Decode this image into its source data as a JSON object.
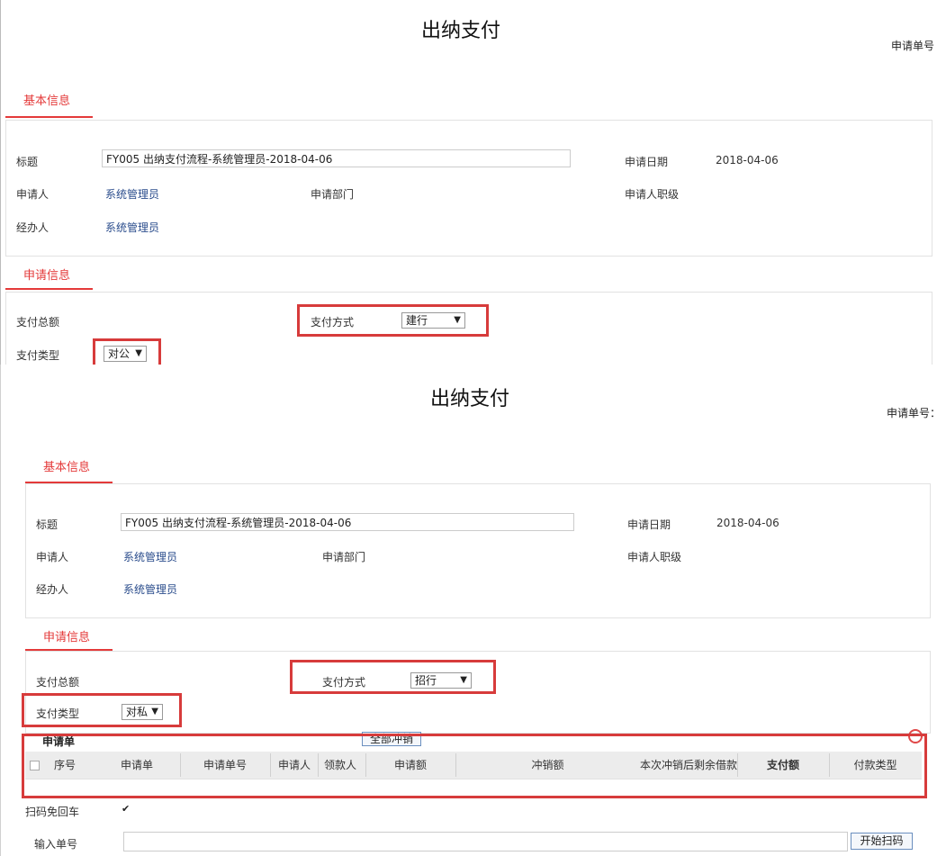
{
  "panel1": {
    "title": "出纳支付",
    "app_no_label": "申请单号",
    "tab_basic": "基本信息",
    "tab_request": "申请信息",
    "fields": {
      "title_label": "标题",
      "title_value": "FY005 出纳支付流程-系统管理员-2018-04-06",
      "date_label": "申请日期",
      "date_value": "2018-04-06",
      "applicant_label": "申请人",
      "applicant_value": "系统管理员",
      "dept_label": "申请部门",
      "rank_label": "申请人职级",
      "handler_label": "经办人",
      "handler_value": "系统管理员"
    },
    "pay": {
      "total_label": "支付总额",
      "method_label": "支付方式",
      "method_value": "建行",
      "type_label": "支付类型",
      "type_value": "对公"
    }
  },
  "panel2": {
    "title": "出纳支付",
    "app_no_label": "申请单号：",
    "tab_basic": "基本信息",
    "tab_request": "申请信息",
    "fields": {
      "title_label": "标题",
      "title_value": "FY005 出纳支付流程-系统管理员-2018-04-06",
      "date_label": "申请日期",
      "date_value": "2018-04-06",
      "applicant_label": "申请人",
      "applicant_value": "系统管理员",
      "dept_label": "申请部门",
      "rank_label": "申请人职级",
      "handler_label": "经办人",
      "handler_value": "系统管理员"
    },
    "pay": {
      "total_label": "支付总额",
      "method_label": "支付方式",
      "method_value": "招行",
      "type_label": "支付类型",
      "type_value": "对私"
    },
    "table": {
      "section_label": "申请单",
      "writeoff_all_button": "全部冲销",
      "columns": [
        "序号",
        "申请单",
        "申请单号",
        "申请人",
        "领款人",
        "申请额",
        "冲销额",
        "本次冲销后剩余借款",
        "支付额",
        "付款类型"
      ]
    },
    "scan": {
      "no_return_label": "扫码免回车",
      "no_return_checked": true,
      "input_label": "输入单号",
      "start_button": "开始扫码"
    }
  },
  "colors": {
    "accent": "#e43a3a",
    "link": "#2a4c8c",
    "highlight_box": "#d73b3b"
  }
}
